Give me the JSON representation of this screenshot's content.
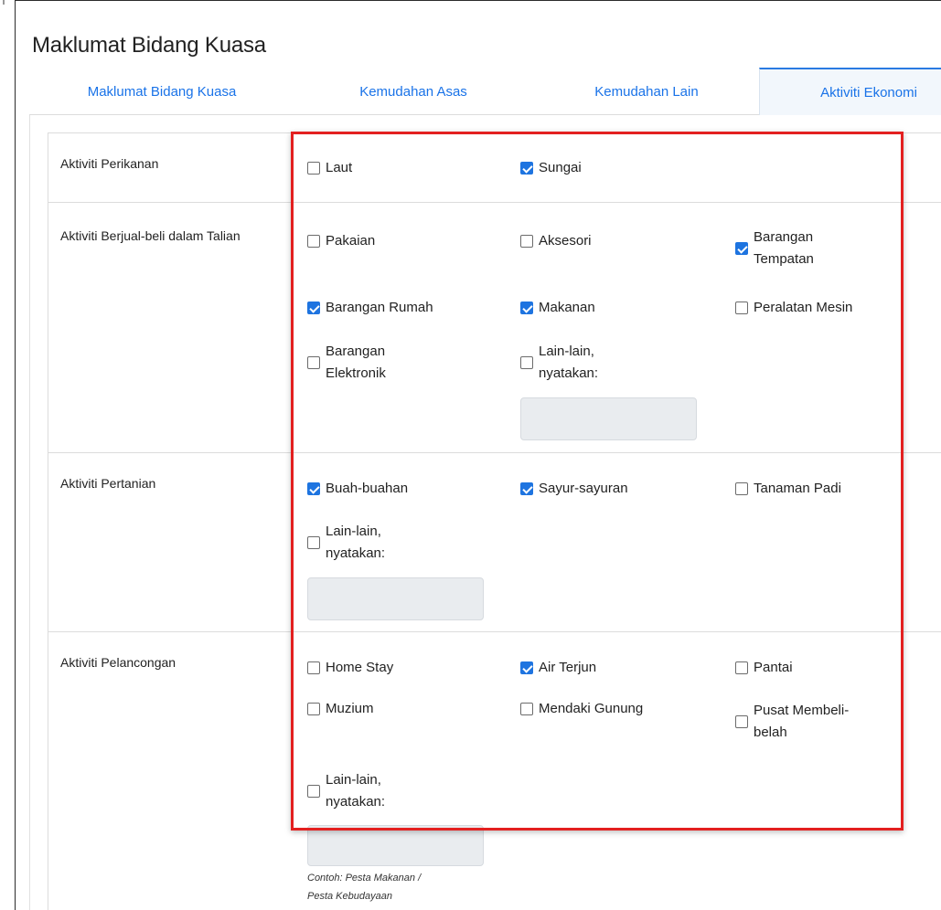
{
  "page": {
    "title": "Maklumat Bidang Kuasa"
  },
  "tabs": [
    {
      "label": "Maklumat Bidang Kuasa",
      "active": false
    },
    {
      "label": "Kemudahan Asas",
      "active": false
    },
    {
      "label": "Kemudahan Lain",
      "active": false
    },
    {
      "label": "Aktiviti Ekonomi",
      "active": true
    }
  ],
  "sections": {
    "perikanan": {
      "label": "Aktiviti Perikanan",
      "options": [
        {
          "label": "Laut",
          "checked": false
        },
        {
          "label": "Sungai",
          "checked": true
        }
      ]
    },
    "jualbeli": {
      "label": "Aktiviti Berjual-beli dalam Talian",
      "options": [
        {
          "label": "Pakaian",
          "checked": false
        },
        {
          "label": "Aksesori",
          "checked": false
        },
        {
          "label": "Barangan\nTempatan",
          "checked": true
        },
        {
          "label": "Barangan Rumah",
          "checked": true
        },
        {
          "label": "Makanan",
          "checked": true
        },
        {
          "label": "Peralatan Mesin",
          "checked": false
        },
        {
          "label": "Barangan\nElektronik",
          "checked": false
        },
        {
          "label": "Lain-lain,\nnyatakan:",
          "checked": false
        }
      ],
      "other_value": ""
    },
    "pertanian": {
      "label": "Aktiviti Pertanian",
      "options": [
        {
          "label": "Buah-buahan",
          "checked": true
        },
        {
          "label": "Sayur-sayuran",
          "checked": true
        },
        {
          "label": "Tanaman Padi",
          "checked": false
        },
        {
          "label": "Lain-lain,\nnyatakan:",
          "checked": false
        }
      ],
      "other_value": ""
    },
    "pelancongan": {
      "label": "Aktiviti Pelancongan",
      "options": [
        {
          "label": "Home Stay",
          "checked": false
        },
        {
          "label": "Air Terjun",
          "checked": true
        },
        {
          "label": "Pantai",
          "checked": false
        },
        {
          "label": "Muzium",
          "checked": false
        },
        {
          "label": "Mendaki Gunung",
          "checked": false
        },
        {
          "label": "Pusat Membeli-\nbelah",
          "checked": false
        },
        {
          "label": "Lain-lain,\nnyatakan:",
          "checked": false
        }
      ],
      "other_value": "",
      "hint": "Contoh: Pesta Makanan /\nPesta Kebudayaan"
    }
  },
  "colors": {
    "accent": "#1e74e0",
    "highlight": "#e32020",
    "field_bg": "#e9ecef"
  }
}
